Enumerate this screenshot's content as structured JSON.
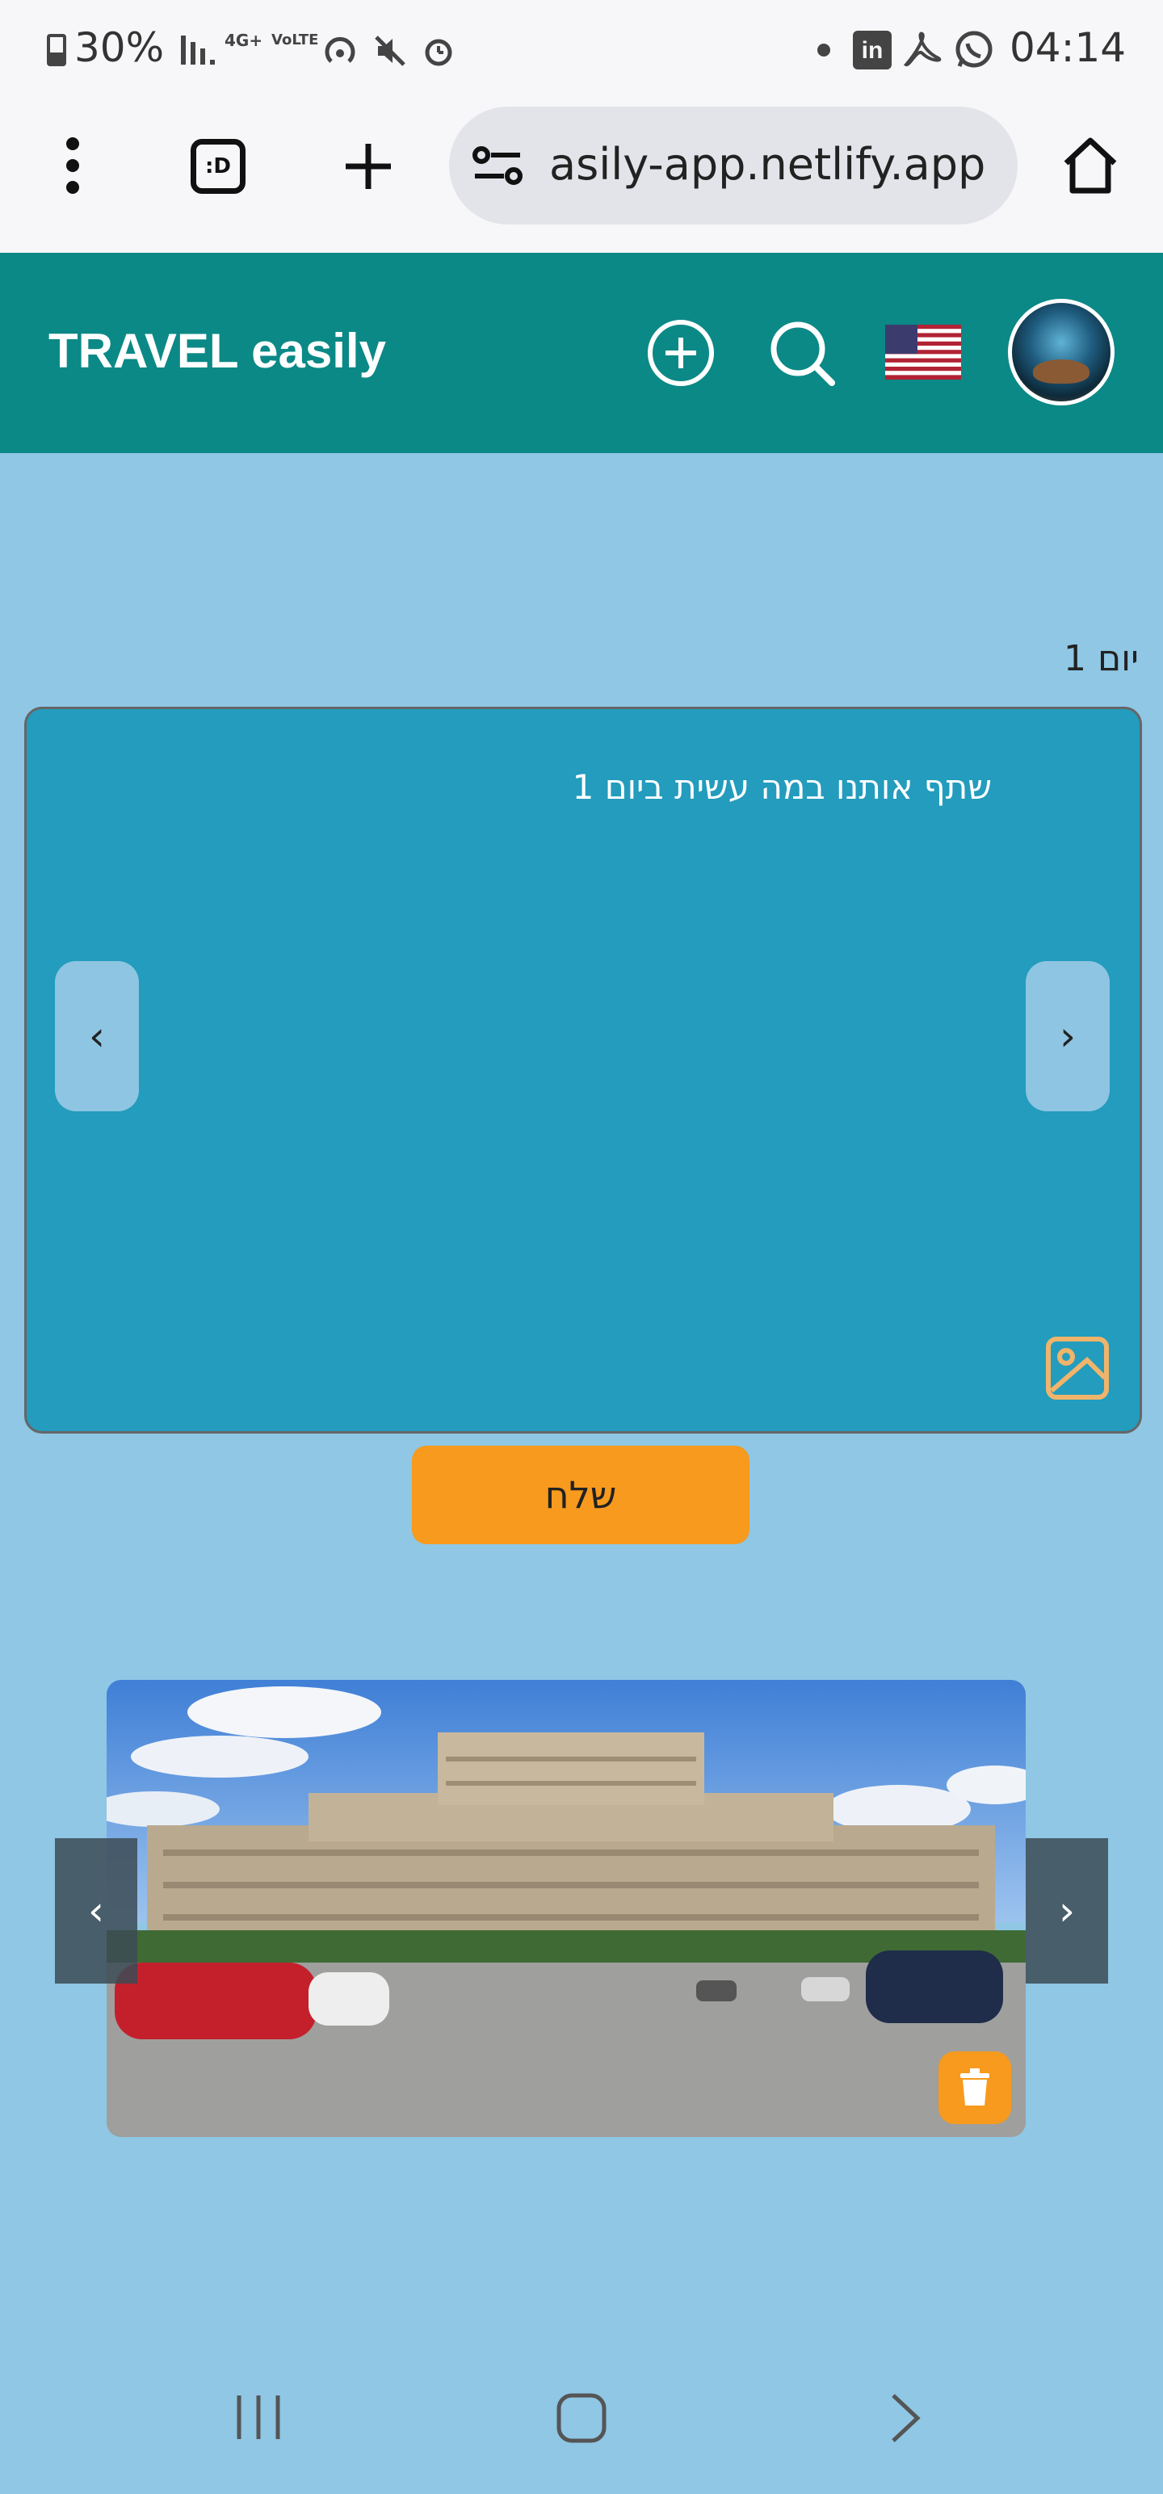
{
  "status_bar": {
    "battery": "30%",
    "network": "4G+",
    "volte": "VoLTE",
    "time": "04:14",
    "icons": [
      "battery-icon",
      "signal-icon",
      "hotspot-icon",
      "mute-icon",
      "alarm-icon",
      "dot-icon",
      "linkedin-icon",
      "acrobat-icon",
      "whatsapp-icon"
    ]
  },
  "browser": {
    "url": "asily-app.netlify.app",
    "icons": [
      "menu-dots-icon",
      "tab-switcher-icon",
      "new-tab-icon",
      "site-settings-icon",
      "home-icon"
    ],
    "tab_label": ":D"
  },
  "app": {
    "brand": "TRAVEL easily",
    "flag": "us-flag-icon",
    "header_color": "#0b8986"
  },
  "day": {
    "label": "יום 1",
    "prompt": "שתף אותנו במה עשית ביום 1",
    "prev": "‹",
    "next": "›",
    "send_label": "שלח"
  },
  "photo": {
    "prev": "‹",
    "next": "›"
  },
  "colors": {
    "page_bg": "#8fc7e5",
    "card_bg": "#239cbd",
    "accent": "#f79a1d"
  }
}
